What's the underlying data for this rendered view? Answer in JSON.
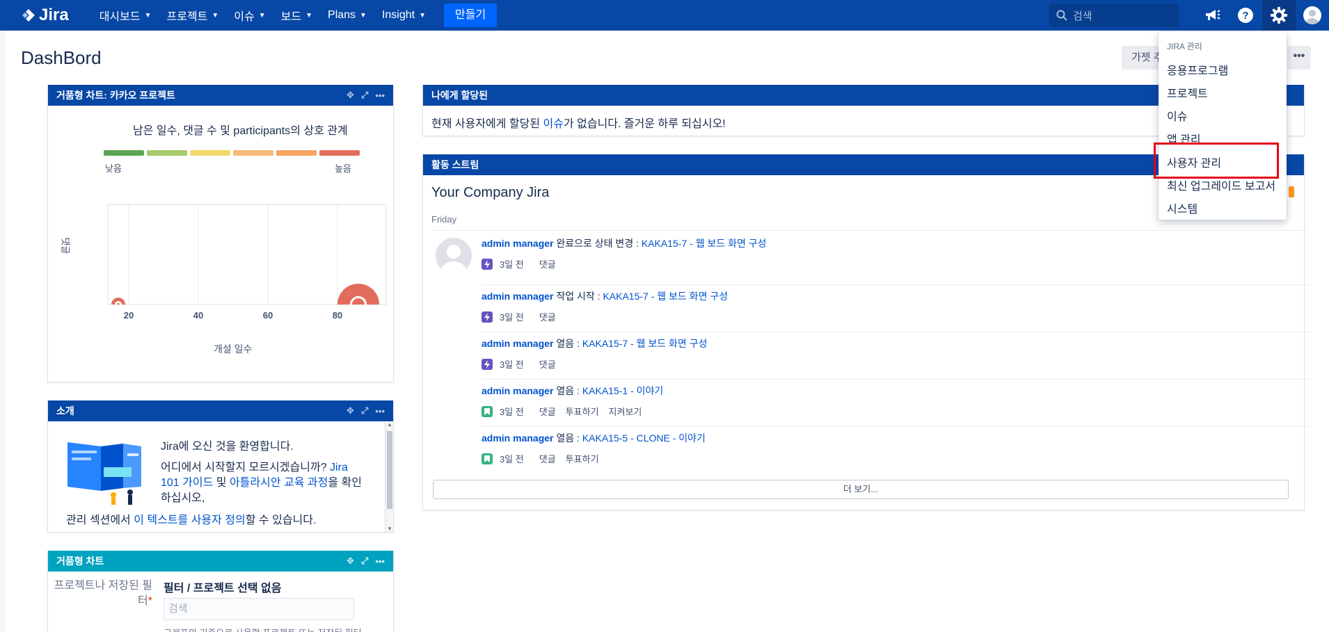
{
  "topnav": {
    "logo": "Jira",
    "items": [
      {
        "label": "대시보드"
      },
      {
        "label": "프로젝트"
      },
      {
        "label": "이슈"
      },
      {
        "label": "보드"
      },
      {
        "label": "Plans"
      },
      {
        "label": "Insight"
      }
    ],
    "create_label": "만들기",
    "search_placeholder": "검색",
    "icons": [
      "megaphone-icon",
      "help-icon",
      "settings-icon",
      "user-avatar"
    ]
  },
  "page": {
    "title": "DashBord",
    "gadget_button": "가젯 추",
    "more_button": "•••"
  },
  "bubble_gadget": {
    "title": "거품형 차트: 카카오 프로젝트",
    "subtitle": "남은 일수, 댓글 수 및 participants의 상호 관계",
    "legend_low": "낮음",
    "legend_high": "높음",
    "legend_colors": [
      "#5aa454",
      "#a6c96a",
      "#f3d86a",
      "#f5b97a",
      "#f4a460",
      "#e26d5c"
    ],
    "ylabel": "댓글",
    "xlabel": "개설 일수"
  },
  "chart_data": {
    "type": "scatter",
    "title": "",
    "subtitle": "남은 일수, 댓글 수 및 participants의 상호 관계",
    "xlabel": "개설 일수",
    "ylabel": "댓글",
    "xlim": [
      14,
      94
    ],
    "x_ticks": [
      20,
      40,
      60,
      80
    ],
    "points": [
      {
        "x": 17,
        "y": 0,
        "size": 1,
        "color": "#e26d5c"
      },
      {
        "x": 86,
        "y": 0,
        "size": 3,
        "color": "#e26d5c"
      }
    ],
    "grid": true
  },
  "intro_gadget": {
    "title": "소개",
    "welcome": "Jira에 오신 것을 환영합니다.",
    "p2_pre": "어디에서 시작할지 모르시겠습니까? ",
    "link1": "Jira 101 가이드",
    "p2_mid": " 및 ",
    "link2": "아틀라시안 교육 과정",
    "p2_post": "을 확인하십시오,",
    "p3_pre": "관리 섹션에서 ",
    "link3": "이 텍스트를 사용자 정의",
    "p3_post": "할 수 있습니다."
  },
  "filter_gadget": {
    "title": "거품형 차트",
    "label": "프로젝트나 저장된 필터",
    "value": "필터 / 프로젝트 선택 없음",
    "search_placeholder": "검색",
    "help": "그래프의 기준으로 사용할 프로젝트 또는 저장된 필터"
  },
  "assigned_gadget": {
    "title": "나에게 할당된",
    "text_pre": "현재 사용자에게 할당된 ",
    "link": "이슈",
    "text_post": "가 없습니다. 즐거운 하루 되십시오!"
  },
  "activity_gadget": {
    "title": "활동 스트림",
    "stream_title": "Your Company Jira",
    "day": "Friday",
    "items": [
      {
        "user": "admin manager",
        "action": " 완료으로 상태 변경 : ",
        "issue": "KAKA15-7 - 웹 보드 화면 구성",
        "time": "3일 전",
        "links": [
          "댓글"
        ],
        "icon_color": "#6554c0"
      },
      {
        "user": "admin manager",
        "action": " 작업 시작 : ",
        "issue": "KAKA15-7 - 웹 보드 화면 구성",
        "time": "3일 전",
        "links": [
          "댓글"
        ],
        "icon_color": "#6554c0"
      },
      {
        "user": "admin manager",
        "action": " 열음 : ",
        "issue": "KAKA15-7 - 웹 보드 화면 구성",
        "time": "3일 전",
        "links": [
          "댓글"
        ],
        "icon_color": "#6554c0"
      },
      {
        "user": "admin manager",
        "action": " 열음 : ",
        "issue": "KAKA15-1 - 이야기",
        "time": "3일 전",
        "links": [
          "댓글",
          "투표하기",
          "지켜보기"
        ],
        "icon_color": "#36b37e"
      },
      {
        "user": "admin manager",
        "action": " 열음 : ",
        "issue": "KAKA15-5 - CLONE - 이야기",
        "time": "3일 전",
        "links": [
          "댓글",
          "투표하기"
        ],
        "icon_color": "#36b37e"
      }
    ],
    "more_label": "더 보기..."
  },
  "admin_menu": {
    "heading": "JIRA 관리",
    "items": [
      "응용프로그램",
      "프로젝트",
      "이슈",
      "앱 관리",
      "사용자 관리",
      "최신 업그레이드 보고서",
      "시스템"
    ],
    "highlighted": "사용자 관리"
  },
  "colors": {
    "nav_bg": "#0747a6",
    "create_btn": "#0065ff",
    "gadget_header": "#0747a6",
    "gadget_header_teal": "#00a3bf",
    "highlight_border": "#e3001b"
  }
}
